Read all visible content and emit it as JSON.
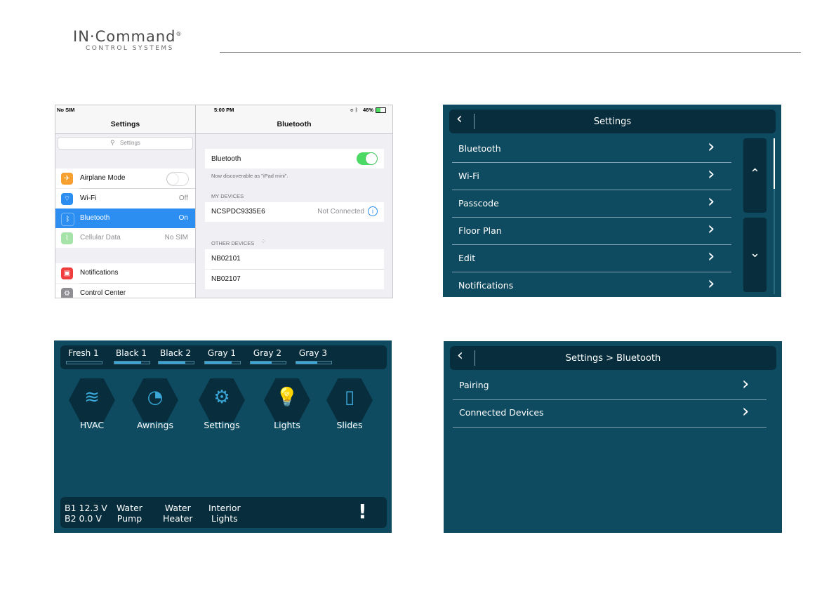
{
  "logo": {
    "main": "IN·Command",
    "reg": "®",
    "sub": "CONTROL SYSTEMS"
  },
  "ipad": {
    "status": {
      "carrier": "No SIM",
      "time": "5:00 PM",
      "battery": "46%"
    },
    "left": {
      "title": "Settings",
      "search_placeholder": "Settings",
      "rows": [
        {
          "label": "Airplane Mode",
          "value": ""
        },
        {
          "label": "Wi-Fi",
          "value": "Off"
        },
        {
          "label": "Bluetooth",
          "value": "On"
        },
        {
          "label": "Cellular Data",
          "value": "No SIM"
        },
        {
          "label": "Notifications",
          "value": ""
        },
        {
          "label": "Control Center",
          "value": ""
        }
      ]
    },
    "right": {
      "title": "Bluetooth",
      "bt_label": "Bluetooth",
      "discoverable": "Now discoverable as \"iPad mini\".",
      "my_devices_header": "MY DEVICES",
      "my_device": {
        "name": "NCSPDC9335E6",
        "status": "Not Connected"
      },
      "other_devices_header": "OTHER DEVICES",
      "other_devices": [
        "NB02101",
        "NB02107"
      ]
    }
  },
  "settings_panel": {
    "title": "Settings",
    "items": [
      "Bluetooth",
      "Wi-Fi",
      "Passcode",
      "Floor Plan",
      "Edit",
      "Notifications"
    ]
  },
  "home_panel": {
    "tanks": [
      {
        "name": "Fresh 1",
        "level": 0.0
      },
      {
        "name": "Black 1",
        "level": 0.75
      },
      {
        "name": "Black 2",
        "level": 0.75
      },
      {
        "name": "Gray 1",
        "level": 0.75
      },
      {
        "name": "Gray 2",
        "level": 0.6
      },
      {
        "name": "Gray 3",
        "level": 0.6
      }
    ],
    "tiles": [
      "HVAC",
      "Awnings",
      "Settings",
      "Lights",
      "Slides"
    ],
    "footer": {
      "b1": "B1  12.3 V",
      "b2": "B2   0.0 V",
      "water_pump_1": "Water",
      "water_pump_2": "Pump",
      "water_heater_1": "Water",
      "water_heater_2": "Heater",
      "interior_lights_1": "Interior",
      "interior_lights_2": "Lights",
      "alert": "!"
    }
  },
  "bt_panel": {
    "title": "Settings > Bluetooth",
    "items": [
      "Pairing",
      "Connected Devices"
    ]
  },
  "colors": {
    "panel_bg": "#0e4a60",
    "bar_bg": "#082e3d",
    "ios_blue": "#2b8ef0",
    "ios_green": "#4cd964"
  }
}
